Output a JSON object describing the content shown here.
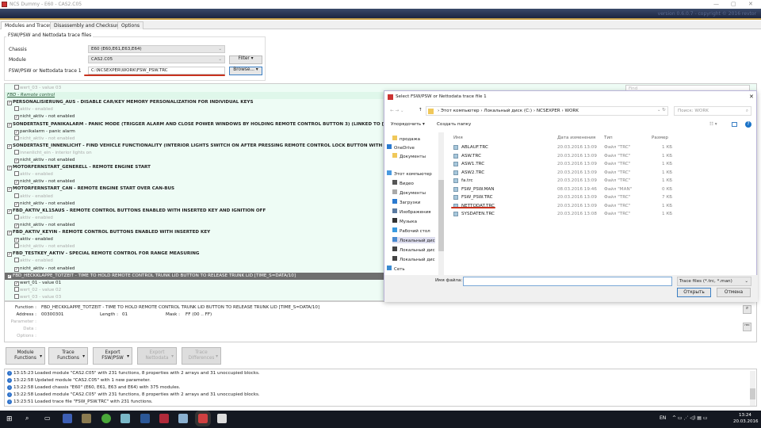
{
  "window": {
    "title": "NCS Dummy - E60 - CAS2.C05",
    "version": "version 0.6.0.7 - copyright © 2016 revtor",
    "minimize": "—",
    "maximize": "▢",
    "close": "✕"
  },
  "tabs": [
    "Modules and Traces",
    "Disassembly and Checksums",
    "Options"
  ],
  "group": {
    "title": "FSW/PSW and Nettodata trace files",
    "chassis_label": "Chassis",
    "chassis_value": "E60  (E60,E61,E63,E64)",
    "module_label": "Module",
    "module_value": "CAS2.C05",
    "filter": "Filter",
    "trace_label": "FSW/PSW or Nettodata trace 1",
    "trace_value": "C:\\NCSEXPER\\WORK\\FSW_PSW.TRC",
    "browse": "Browse..."
  },
  "find": {
    "placeholder": "Find"
  },
  "accent": "#c8321e",
  "tree": [
    {
      "t": "wert_03  -  value 03",
      "lvl": 1,
      "c": false,
      "s": "dim"
    },
    {
      "t": "FBD  -  Remote control",
      "lvl": 0,
      "s": "h"
    },
    {
      "t": "PERSONALISIERUNG_AUS  -  DISABLE CAR/KEY MEMORY PERSONALIZATION FOR INDIVIDUAL KEYS",
      "lvl": 0,
      "c": true,
      "s": "b"
    },
    {
      "t": "aktiv  -  enabled",
      "lvl": 1,
      "c": false,
      "s": "dim"
    },
    {
      "t": "nicht_aktiv  -  not enabled",
      "lvl": 1,
      "c": true,
      "s": ""
    },
    {
      "t": "SONDERTASTE_PANIKALARM  -  PANIC MODE (TRIGGER ALARM AND CLOSE POWER WINDOWS BY HOLDING REMOTE CONTROL BUTTON 3) (LINKED TO [FBD_PANIK_TO",
      "lvl": 0,
      "c": true,
      "s": "b"
    },
    {
      "t": "panikalarm  -  panic alarm",
      "lvl": 1,
      "c": true,
      "s": ""
    },
    {
      "t": "nicht_aktiv  -  not enabled",
      "lvl": 1,
      "c": false,
      "s": "dim"
    },
    {
      "t": "SONDERTASTE_INNENLICHT  -  FIND VEHICLE FUNCTIONALITY (INTERIOR LIGHTS SWITCH ON AFTER PRESSING REMOTE CONTROL LOCK BUTTON WITH VEHICLE LOCKE",
      "lvl": 0,
      "c": true,
      "s": "b"
    },
    {
      "t": "innenlicht_ein  -  interior lights on",
      "lvl": 1,
      "c": false,
      "s": "dim"
    },
    {
      "t": "nicht_aktiv  -  not enabled",
      "lvl": 1,
      "c": true,
      "s": ""
    },
    {
      "t": "MOTORFERNSTART_GENERELL  -  REMOTE ENGINE START",
      "lvl": 0,
      "c": true,
      "s": "b"
    },
    {
      "t": "aktiv  -  enabled",
      "lvl": 1,
      "c": false,
      "s": "dim"
    },
    {
      "t": "nicht_aktiv  -  not enabled",
      "lvl": 1,
      "c": true,
      "s": ""
    },
    {
      "t": "MOTORFERNSTART_CAN  -  REMOTE ENGINE START OVER CAN-BUS",
      "lvl": 0,
      "c": true,
      "s": "b"
    },
    {
      "t": "aktiv  -  enabled",
      "lvl": 1,
      "c": false,
      "s": "dim"
    },
    {
      "t": "nicht_aktiv  -  not enabled",
      "lvl": 1,
      "c": true,
      "s": ""
    },
    {
      "t": "FBD_AKTIV_KL15AUS  -  REMOTE CONTROL BUTTONS ENABLED WITH INSERTED KEY AND IGNITION OFF",
      "lvl": 0,
      "c": true,
      "s": "b"
    },
    {
      "t": "aktiv  -  enabled",
      "lvl": 1,
      "c": false,
      "s": "dim"
    },
    {
      "t": "nicht_aktiv  -  not enabled",
      "lvl": 1,
      "c": true,
      "s": ""
    },
    {
      "t": "FBD_AKTIV_KEYIN  -  REMOTE CONTROL BUTTONS ENABLED WITH INSERTED KEY",
      "lvl": 0,
      "c": true,
      "s": "b"
    },
    {
      "t": "aktiv  -  enabled",
      "lvl": 1,
      "c": true,
      "s": ""
    },
    {
      "t": "nicht_aktiv  -  not enabled",
      "lvl": 1,
      "c": false,
      "s": "dim"
    },
    {
      "t": "FBD_TESTKEY_AKTIV  -  SPECIAL REMOTE CONTROL FOR RANGE MEASURING",
      "lvl": 0,
      "c": true,
      "s": "b"
    },
    {
      "t": "aktiv  -  enabled",
      "lvl": 1,
      "c": false,
      "s": "dim"
    },
    {
      "t": "nicht_aktiv  -  not enabled",
      "lvl": 1,
      "c": true,
      "s": ""
    },
    {
      "t": "FBD_HECKKLAPPE_TOTZEIT  -  TIME TO HOLD REMOTE CONTROL TRUNK LID BUTTON TO RELEASE TRUNK LID [TIME_S=DATA/10]",
      "lvl": 0,
      "c": true,
      "s": "sel"
    },
    {
      "t": "wert_01  -  value 01",
      "lvl": 1,
      "c": true,
      "s": ""
    },
    {
      "t": "wert_02  -  value 02",
      "lvl": 1,
      "c": false,
      "s": "dim"
    },
    {
      "t": "wert_03  -  value 03",
      "lvl": 1,
      "c": false,
      "s": "dim"
    }
  ],
  "info": {
    "function_label": "Function :",
    "function_value": "FBD_HECKKLAPPE_TOTZEIT  -  TIME TO HOLD REMOTE CONTROL TRUNK LID BUTTON TO RELEASE TRUNK LID [TIME_S=DATA/10]",
    "address_label": "Address :",
    "address_value": "00300301",
    "length_label": "Length :",
    "length_value": "01",
    "mask_label": "Mask :",
    "mask_value": "FF  (00 .. FF)",
    "parameter_label": "Parameter :",
    "data_label": "Data :",
    "options_label": "Options :"
  },
  "buttons": [
    {
      "l1": "Module",
      "l2": "Functions",
      "enabled": true
    },
    {
      "l1": "Trace",
      "l2": "Functions",
      "enabled": true
    },
    {
      "l1": "Export",
      "l2": "FSW/PSW",
      "enabled": true
    },
    {
      "l1": "Export",
      "l2": "Nettodata",
      "enabled": false
    },
    {
      "l1": "Trace",
      "l2": "Differences",
      "enabled": false
    }
  ],
  "log": [
    "13:15:23  Loaded module \"CAS2.C05\" with 231 functions, 8 properties with 2 arrays and 31 unoccupied blocks.",
    "13:22:58  Updated module \"CAS2.C05\" with 1 new parameter.",
    "13:22:58  Loaded chassis \"E60\" (E60, E61, E63 and E64) with 375 modules.",
    "13:22:58  Loaded module \"CAS2.C05\" with 231 functions, 8 properties with 2 arrays and 31 unoccupied blocks.",
    "13:23:51  Loaded trace file \"FSW_PSW.TRC\" with 231 functions."
  ],
  "dialog": {
    "title": "Select FSW/PSW or Nettodata trace file 1",
    "breadcrumb": [
      "Этот компьютер",
      "Локальный диск (C:)",
      "NCSEXPER",
      "WORK"
    ],
    "search_placeholder": "Поиск: WORK",
    "organize": "Упорядочить ▾",
    "new_folder": "Создать папку",
    "columns": [
      "Имя",
      "Дата изменения",
      "Тип",
      "Размер"
    ],
    "nav": [
      "продажа",
      "OneDrive",
      "Документы",
      "Этот компьютер",
      "Видео",
      "Документы",
      "Загрузки",
      "Изображения",
      "Музыка",
      "Рабочий стол",
      "Локальный дис",
      "Локальный дис",
      "Локальный дис",
      "Сеть"
    ],
    "files": [
      [
        "ABLAUF.TRC",
        "20.03.2016 13:09",
        "Файл \"TRC\"",
        "1 КБ"
      ],
      [
        "ASW.TRC",
        "20.03.2016 13:09",
        "Файл \"TRC\"",
        "1 КБ"
      ],
      [
        "ASW1.TRC",
        "20.03.2016 13:09",
        "Файл \"TRC\"",
        "1 КБ"
      ],
      [
        "ASW2.TRC",
        "20.03.2016 13:09",
        "Файл \"TRC\"",
        "1 КБ"
      ],
      [
        "fa.trc",
        "20.03.2016 13:09",
        "Файл \"TRC\"",
        "1 КБ"
      ],
      [
        "FSW_PSW.MAN",
        "08.03.2016 19:46",
        "Файл \"MAN\"",
        "0 КБ"
      ],
      [
        "FSW_PSW.TRC",
        "20.03.2016 13:09",
        "Файл \"TRC\"",
        "7 КБ"
      ],
      [
        "NETTODAT.TRC",
        "20.03.2016 13:09",
        "Файл \"TRC\"",
        "1 КБ"
      ],
      [
        "SYSDATEN.TRC",
        "20.03.2016 13:08",
        "Файл \"TRC\"",
        "1 КБ"
      ]
    ],
    "filename_label": "Имя файла:",
    "filename_value": "",
    "filetype": "Trace files (*.trc, *.man)",
    "open": "Открыть",
    "cancel": "Отмена"
  },
  "taskbar": {
    "lang": "EN",
    "time": "13:24",
    "date": "20.03.2016"
  }
}
